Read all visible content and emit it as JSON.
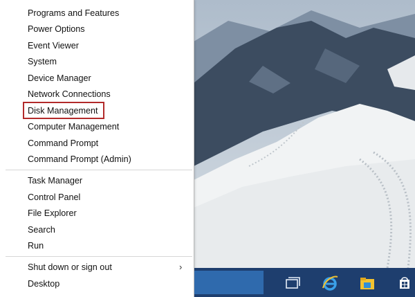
{
  "menu": {
    "items": [
      "Programs and Features",
      "Power Options",
      "Event Viewer",
      "System",
      "Device Manager",
      "Network Connections",
      "Disk Management",
      "Computer Management",
      "Command Prompt",
      "Command Prompt (Admin)",
      "Task Manager",
      "Control Panel",
      "File Explorer",
      "Search",
      "Run",
      "Shut down or sign out",
      "Desktop"
    ],
    "submenu_arrow": "›",
    "highlighted_item": "Disk Management",
    "highlight_color": "#b22a2a"
  },
  "taskbar": {
    "color": "#1e3e6e",
    "search_color": "#2f6aad",
    "icons": [
      "task-view-icon",
      "internet-explorer-icon",
      "file-explorer-icon",
      "store-icon"
    ]
  }
}
